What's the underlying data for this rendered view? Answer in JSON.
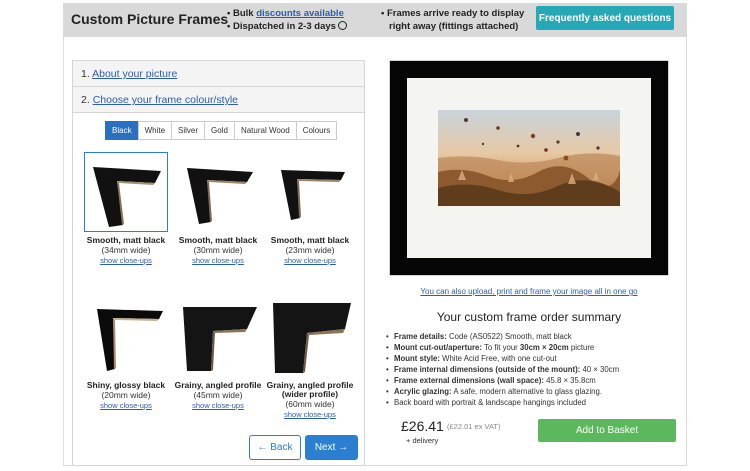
{
  "header": {
    "brand": "Custom Picture Frames",
    "bullet1_prefix": "• Bulk ",
    "bullet1_link": "discounts available",
    "bullet2": "• Dispatched in 2-3 days",
    "bullet3_line1": "• Frames arrive ready to display",
    "bullet3_line2": "right away (fittings attached)",
    "faq_button": "Frequently asked questions"
  },
  "steps": [
    {
      "number": "1.",
      "label": "About your picture"
    },
    {
      "number": "2.",
      "label": "Choose your frame colour/style"
    }
  ],
  "color_tabs": [
    "Black",
    "White",
    "Silver",
    "Gold",
    "Natural Wood",
    "Colours"
  ],
  "active_tab": "Black",
  "frames": [
    {
      "name": "Smooth, matt black",
      "width": "(34mm wide)",
      "link": "show close-ups"
    },
    {
      "name": "Smooth, matt black",
      "width": "(30mm wide)",
      "link": "show close-ups"
    },
    {
      "name": "Smooth, matt black",
      "width": "(23mm wide)",
      "link": "show close-ups"
    },
    {
      "name": "Shiny, glossy black",
      "width": "(20mm wide)",
      "link": "show close-ups"
    },
    {
      "name": "Grainy, angled profile",
      "width": "(45mm wide)",
      "link": "show close-ups"
    },
    {
      "name": "Grainy, angled profile (wider profile)",
      "width": "(60mm wide)",
      "link": "show close-ups"
    }
  ],
  "nav": {
    "back": "← Back",
    "next": "Next →"
  },
  "preview": {
    "upload_link": "You can also upload, print and frame your image all in one go"
  },
  "summary": {
    "title": "Your custom frame order summary",
    "items": [
      {
        "label": "Frame details:",
        "value": " Code (AS0522) Smooth, matt black"
      },
      {
        "label": "Mount cut-out/aperture:",
        "value": " To fit your ",
        "bold": "30cm × 20cm",
        "suffix": " picture"
      },
      {
        "label": "Mount style:",
        "value": " White Acid Free, with one cut-out"
      },
      {
        "label": "Frame internal dimensions (outside of the mount):",
        "value": " 40 × 30cm"
      },
      {
        "label": "Frame external dimensions (wall space):",
        "value": " 45.8 × 35.8cm"
      },
      {
        "label": "Acrylic glazing:",
        "value": " A safe, modern alternative to glass glazing."
      },
      {
        "label": "",
        "value": "Back board with portrait & landscape hangings included"
      }
    ]
  },
  "pricing": {
    "price": "£26.41",
    "ex_vat": "(£22.01 ex VAT)",
    "delivery": "+ delivery",
    "basket_button": "Add to Basket"
  },
  "colors": {
    "accent_blue": "#2a7fd0",
    "faq_teal": "#26a9b7",
    "basket_green": "#5cb85c",
    "frame_black": "#050505"
  }
}
